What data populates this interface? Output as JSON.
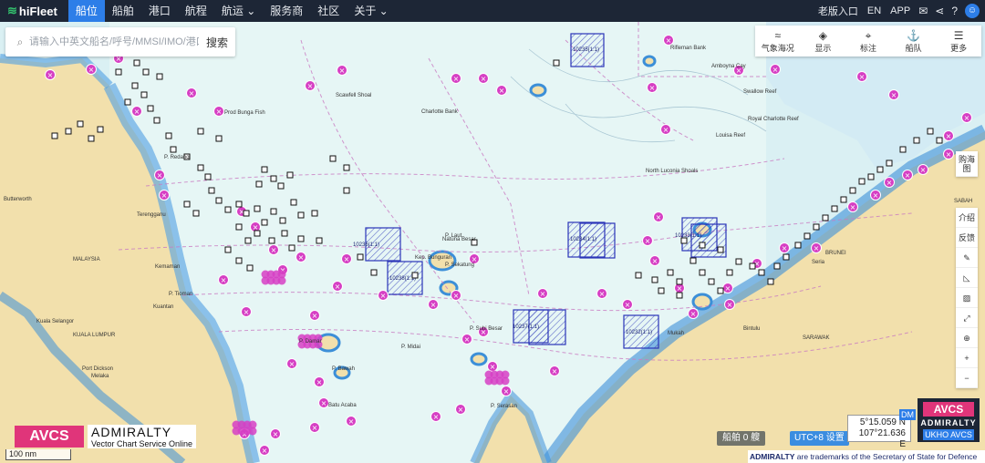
{
  "brand": {
    "name": "hiFleet"
  },
  "nav": {
    "items": [
      "船舶",
      "港口",
      "航程",
      "航运",
      "服务商",
      "社区",
      "关于"
    ],
    "active_index": 0,
    "active_label": "船位"
  },
  "nav_right": {
    "old_version": "老版入口",
    "lang": "EN",
    "app": "APP"
  },
  "search": {
    "placeholder": "请输入中英文船名/呼号/MMSI/IMO/港口名",
    "button": "搜索"
  },
  "tools": [
    {
      "label": "气象海况",
      "icon": "weather-icon"
    },
    {
      "label": "显示",
      "icon": "layers-icon"
    },
    {
      "label": "标注",
      "icon": "pin-icon"
    },
    {
      "label": "船队",
      "icon": "fleet-icon"
    },
    {
      "label": "更多",
      "icon": "menu-icon"
    }
  ],
  "vbar1": [
    "购海图"
  ],
  "vbar2": [
    "介绍",
    "反馈"
  ],
  "map_labels": {
    "places": [
      "Kuala Selangor",
      "KUALA LUMPUR",
      "MALAYSIA",
      "Port Dickson",
      "Melaka",
      "Butterworth",
      "Kuantan",
      "Terengganu",
      "Mukah",
      "Bintulu",
      "SARAWAK",
      "SABAH",
      "BRUNEI",
      "Seria",
      "Kemaman",
      "P. Redang",
      "P. Tioman"
    ],
    "features": [
      "Louisa Reef",
      "North Luconia Shoals",
      "Royal Charlotte Reef",
      "Charlotte Bank",
      "Scawfell Shoal",
      "Prod Bunga Fish",
      "Rifleman Bank",
      "Amboyna Cay",
      "Swallow Reef",
      "P. Sekatung",
      "Natuna Besar",
      "P. Subi Besar",
      "Kep. Bunguran",
      "P. Damar",
      "P. Bawah",
      "Batu Acaba",
      "P. Midai",
      "P. Serasan",
      "P. Laut"
    ]
  },
  "chart_boxes": [
    "10235(1:1)",
    "10236(1:1)",
    "10238(1:1)",
    "10234(1:1)",
    "10233(1:1)",
    "10237(1:1)",
    "10232(1:1)"
  ],
  "scale_label": "100 nm",
  "avcs": {
    "badge": "AVCS",
    "title": "ADMIRALTY",
    "subtitle": "Vector Chart Service Online"
  },
  "status": {
    "ship_count": "船舶 0 艘",
    "utc": "UTC+8 设置"
  },
  "coords": {
    "lat": "5°15.059 N",
    "lon": "107°21.636 E",
    "format": "DM"
  },
  "ukho": {
    "badge": "AVCS",
    "title": "ADMIRALTY",
    "sub": "UKHO AVCS"
  },
  "trademark": {
    "brand": "ADMIRALTY",
    "text": "are trademarks of the Secretary of State for Defence"
  },
  "colors": {
    "nav_bg": "#1d2636",
    "accent": "#2d7ee8",
    "avcs_pink": "#e0357a",
    "sea": "#d9f0f2",
    "deep": "#e8f6f6",
    "land": "#f3e2b0",
    "shallow": "#5aa7e6",
    "wreck": "#d63fc4"
  }
}
